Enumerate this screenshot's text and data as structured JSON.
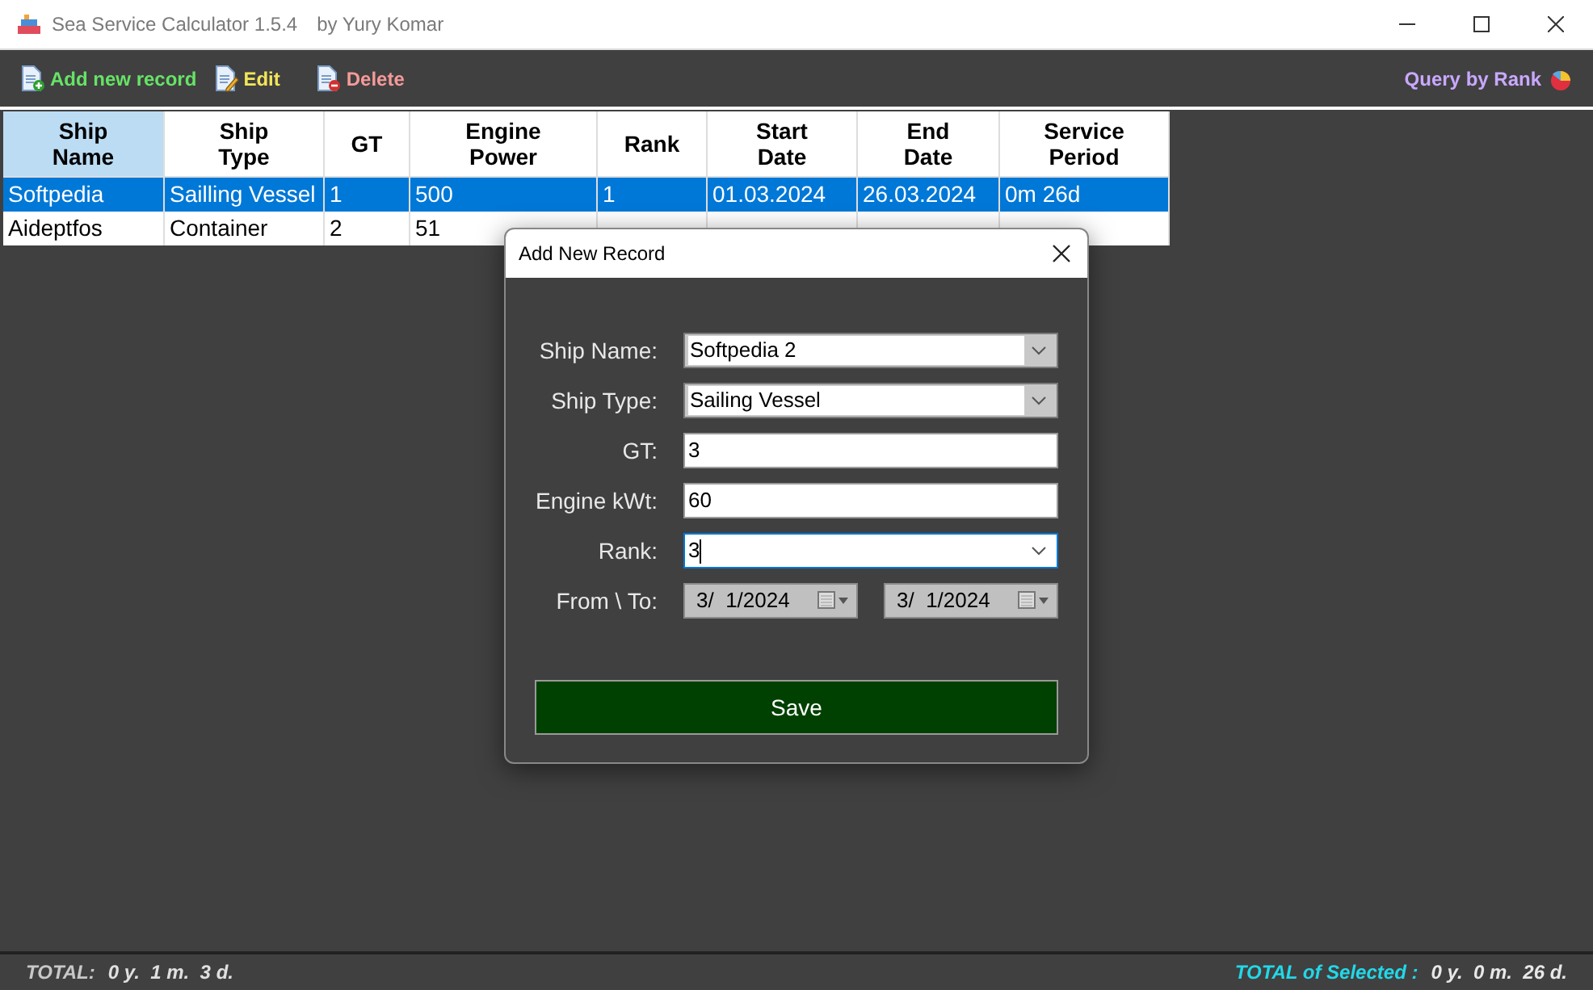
{
  "window": {
    "title": "Sea Service Calculator 1.5.4",
    "author": "by Yury Komar"
  },
  "toolbar": {
    "left": [
      {
        "label": "Add new record",
        "color": "#66e366",
        "kind": "add"
      },
      {
        "label": "Edit",
        "color": "#f2e55a",
        "kind": "edit"
      },
      {
        "label": "Delete",
        "color": "#f59a9a",
        "kind": "delete"
      }
    ],
    "right": {
      "label": "Query by Rank",
      "color": "#c9a8ff"
    }
  },
  "table": {
    "columns": [
      {
        "label": "Ship\nName",
        "selected": true
      },
      {
        "label": "Ship\nType",
        "selected": false
      },
      {
        "label": "GT",
        "selected": false
      },
      {
        "label": "Engine\nPower",
        "selected": false
      },
      {
        "label": "Rank",
        "selected": false
      },
      {
        "label": "Start\nDate",
        "selected": false
      },
      {
        "label": "End\nDate",
        "selected": false
      },
      {
        "label": "Service\nPeriod",
        "selected": false
      }
    ],
    "rows": [
      {
        "selected": true,
        "cells": [
          "Softpedia",
          "Sailling Vessel",
          "1",
          "500",
          "1",
          "01.03.2024",
          "26.03.2024",
          "0m 26d"
        ]
      },
      {
        "selected": false,
        "cells": [
          "Aideptfos",
          "Container",
          "2",
          "51"
        ]
      }
    ]
  },
  "dialog": {
    "title": "Add New Record",
    "fields": [
      {
        "label": "Ship Name:",
        "kind": "combo",
        "value": "Softpedia 2",
        "focused": false
      },
      {
        "label": "Ship Type:",
        "kind": "combo",
        "value": "Sailing Vessel",
        "focused": false
      },
      {
        "label": "GT:",
        "kind": "text",
        "value": "3",
        "focused": false
      },
      {
        "label": "Engine kWt:",
        "kind": "text",
        "value": "60",
        "focused": false
      },
      {
        "label": "Rank:",
        "kind": "editcombo",
        "value": "3",
        "focused": true
      },
      {
        "label": "From \\ To:",
        "kind": "dates",
        "values": [
          "3/  1/2024",
          "3/  1/2024"
        ],
        "focused": false
      }
    ],
    "save": "Save"
  },
  "status_bar": {
    "total_label": "TOTAL:",
    "total_value": "0 y.  1 m.  3 d.",
    "selected_label": "TOTAL of Selected :",
    "selected_value": "0 y.  0 m.  26 d."
  }
}
